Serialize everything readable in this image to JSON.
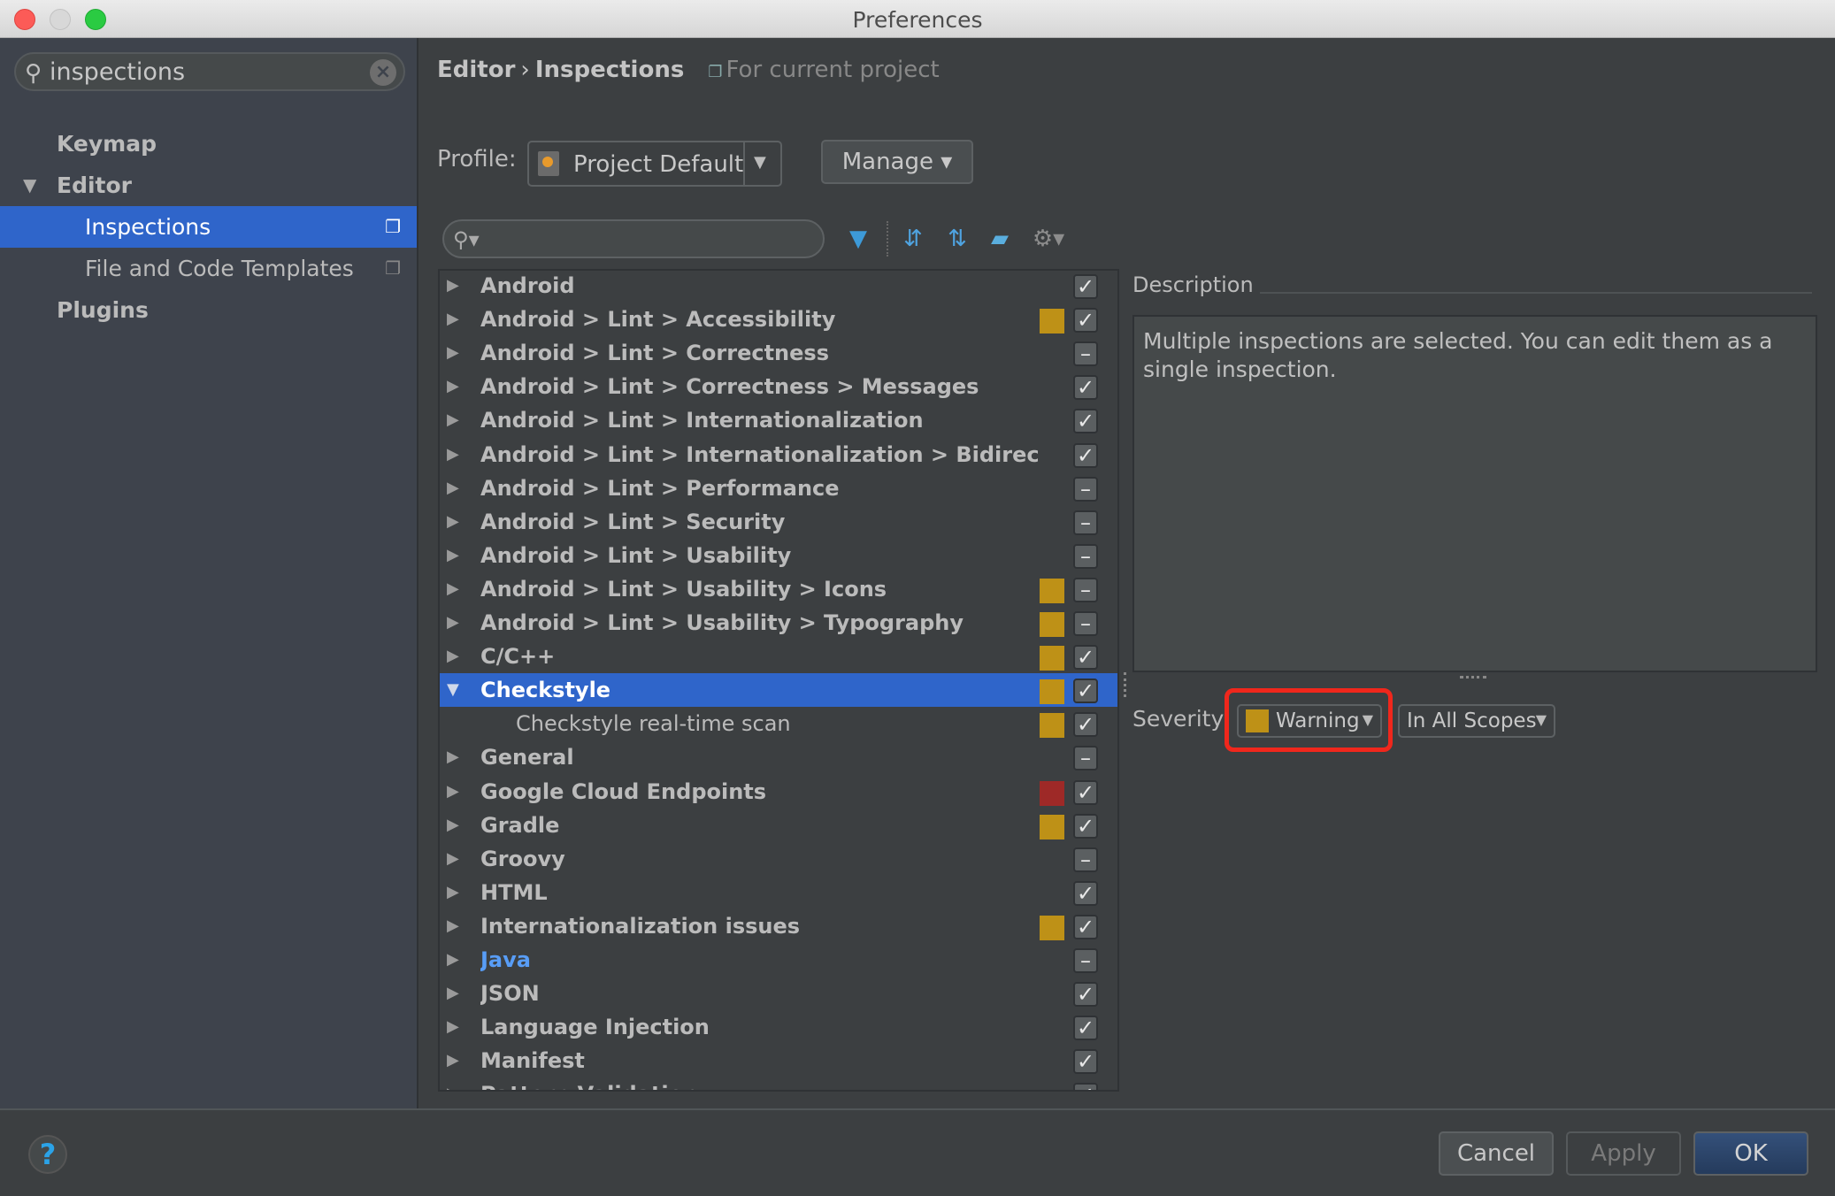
{
  "window": {
    "title": "Preferences"
  },
  "sidebar": {
    "search": {
      "value": "inspections",
      "placeholder": ""
    },
    "items": [
      {
        "label": "Keymap",
        "level": 0,
        "expanded": null,
        "selected": false,
        "has_project_icon": false
      },
      {
        "label": "Editor",
        "level": 0,
        "expanded": true,
        "selected": false,
        "has_project_icon": false
      },
      {
        "label": "Inspections",
        "level": 1,
        "expanded": null,
        "selected": true,
        "has_project_icon": true
      },
      {
        "label": "File and Code Templates",
        "level": 1,
        "expanded": null,
        "selected": false,
        "has_project_icon": true
      },
      {
        "label": "Plugins",
        "level": 0,
        "expanded": null,
        "selected": false,
        "has_project_icon": false
      }
    ]
  },
  "breadcrumb": {
    "parts": [
      "Editor",
      "Inspections"
    ],
    "separator": "›",
    "scope_label": "For current project"
  },
  "profile": {
    "label": "Profile:",
    "value": "Project Default",
    "manage_label": "Manage ▾"
  },
  "toolbar": {
    "search_placeholder": "",
    "icons": [
      "filter-icon",
      "expand-all-icon",
      "collapse-all-icon",
      "reset-eraser-icon",
      "gear-icon"
    ]
  },
  "tree": {
    "rows": [
      {
        "name": "Android",
        "severity": null,
        "check": "checked",
        "expanded": false
      },
      {
        "name": "Android > Lint > Accessibility",
        "severity": "warning",
        "check": "checked",
        "expanded": false
      },
      {
        "name": "Android > Lint > Correctness",
        "severity": null,
        "check": "partial",
        "expanded": false
      },
      {
        "name": "Android > Lint > Correctness > Messages",
        "severity": null,
        "check": "checked",
        "expanded": false
      },
      {
        "name": "Android > Lint > Internationalization",
        "severity": null,
        "check": "checked",
        "expanded": false
      },
      {
        "name": "Android > Lint > Internationalization > Bidirectio",
        "severity": null,
        "check": "checked",
        "expanded": false
      },
      {
        "name": "Android > Lint > Performance",
        "severity": null,
        "check": "partial",
        "expanded": false
      },
      {
        "name": "Android > Lint > Security",
        "severity": null,
        "check": "partial",
        "expanded": false
      },
      {
        "name": "Android > Lint > Usability",
        "severity": null,
        "check": "partial",
        "expanded": false
      },
      {
        "name": "Android > Lint > Usability > Icons",
        "severity": "warning",
        "check": "partial",
        "expanded": false
      },
      {
        "name": "Android > Lint > Usability > Typography",
        "severity": "warning",
        "check": "partial",
        "expanded": false
      },
      {
        "name": "C/C++",
        "severity": "warning",
        "check": "checked",
        "expanded": false
      },
      {
        "name": "Checkstyle",
        "severity": "warning",
        "check": "checked",
        "expanded": true,
        "selected": true
      },
      {
        "name": "Checkstyle real-time scan",
        "severity": "warning",
        "check": "checked",
        "child": true
      },
      {
        "name": "General",
        "severity": null,
        "check": "partial",
        "expanded": false
      },
      {
        "name": "Google Cloud Endpoints",
        "severity": "error",
        "check": "checked",
        "expanded": false
      },
      {
        "name": "Gradle",
        "severity": "warning",
        "check": "checked",
        "expanded": false
      },
      {
        "name": "Groovy",
        "severity": null,
        "check": "partial",
        "expanded": false
      },
      {
        "name": "HTML",
        "severity": null,
        "check": "checked",
        "expanded": false
      },
      {
        "name": "Internationalization issues",
        "severity": "warning",
        "check": "checked",
        "expanded": false
      },
      {
        "name": "Java",
        "severity": null,
        "check": "partial",
        "expanded": false,
        "link": true
      },
      {
        "name": "JSON",
        "severity": null,
        "check": "checked",
        "expanded": false
      },
      {
        "name": "Language Injection",
        "severity": null,
        "check": "checked",
        "expanded": false
      },
      {
        "name": "Manifest",
        "severity": null,
        "check": "checked",
        "expanded": false
      },
      {
        "name": "Pattern Validation",
        "severity": null,
        "check": "checked",
        "expanded": false
      }
    ]
  },
  "description": {
    "label": "Description",
    "text": "Multiple inspections are selected. You can edit them as a single inspection."
  },
  "severity": {
    "label": "Severity:",
    "value": "Warning",
    "scope": "In All Scopes"
  },
  "colors": {
    "warning": "#be9117",
    "error": "#9e2927",
    "selection": "#2f65ca",
    "highlight_box": "#f0271c",
    "link": "#589df6"
  },
  "footer": {
    "help_label": "?",
    "cancel_label": "Cancel",
    "apply_label": "Apply",
    "ok_label": "OK"
  }
}
